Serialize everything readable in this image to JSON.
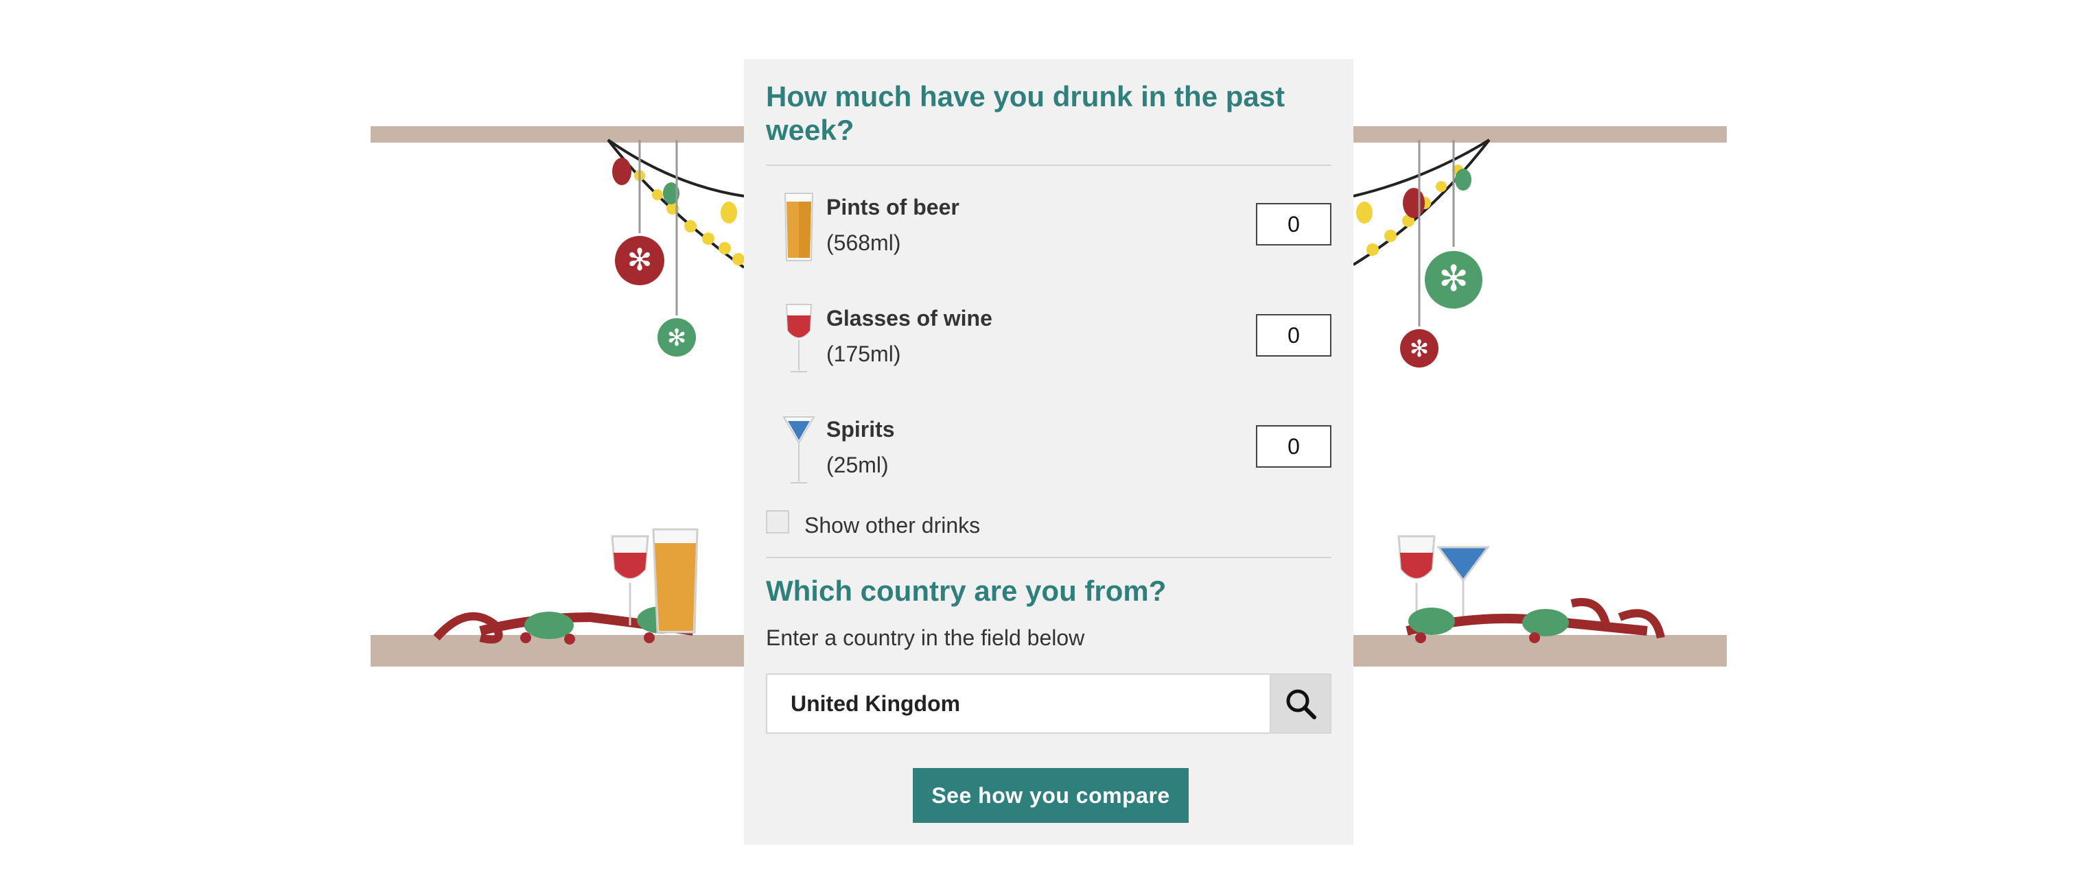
{
  "colors": {
    "accent": "#2f7f7c",
    "panel_bg": "#f1f1f1",
    "shelf": "#c8b5a8",
    "bauble_red": "#a52a2f",
    "bauble_green": "#4f9d6b",
    "bulb_yellow": "#f2d23a"
  },
  "question": {
    "title": "How much have you drunk in the past week?"
  },
  "drinks": [
    {
      "name": "Pints of beer",
      "size": "(568ml)",
      "value": "0",
      "icon": "beer-glass-icon"
    },
    {
      "name": "Glasses of wine",
      "size": "(175ml)",
      "value": "0",
      "icon": "wine-glass-icon"
    },
    {
      "name": "Spirits",
      "size": "(25ml)",
      "value": "0",
      "icon": "cocktail-glass-icon"
    }
  ],
  "other_drinks": {
    "label": "Show other drinks",
    "checked": false
  },
  "country": {
    "title": "Which country are you from?",
    "hint": "Enter a country in the field below",
    "value": "United Kingdom",
    "search_icon": "search-icon"
  },
  "submit": {
    "label": "See how you compare"
  }
}
